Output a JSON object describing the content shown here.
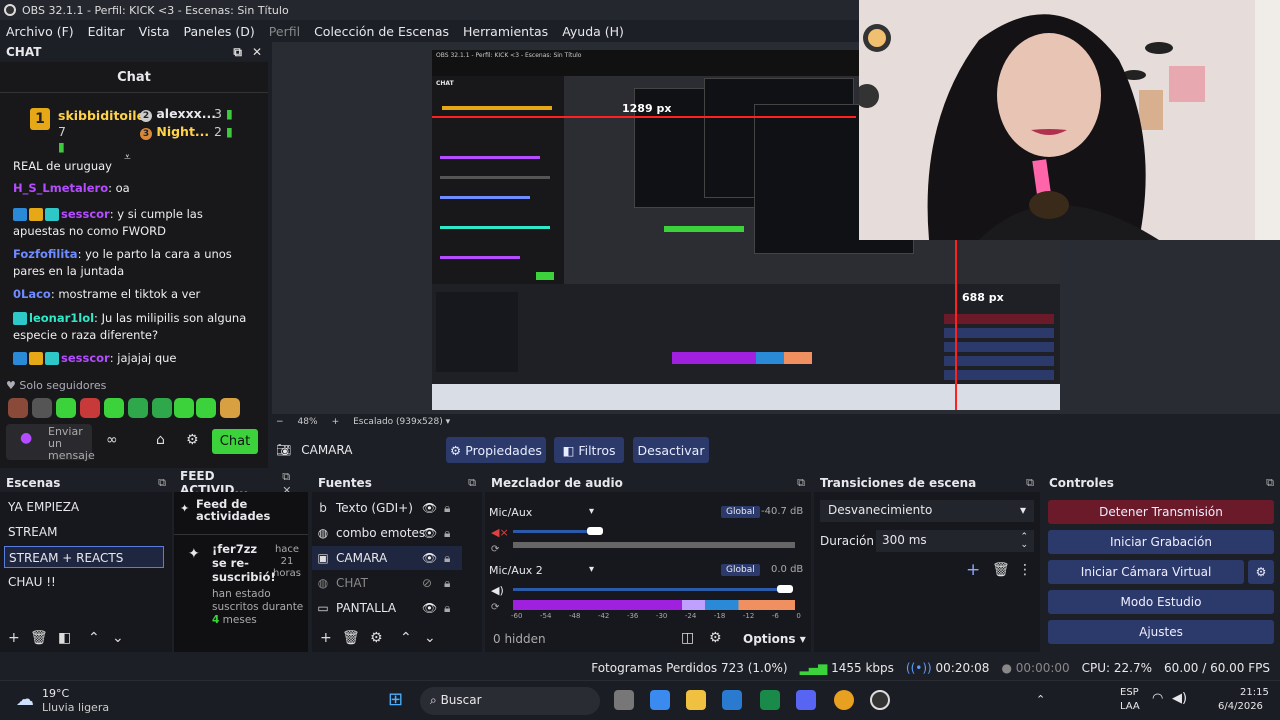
{
  "window": {
    "title": "OBS 32.1.1 - Perfil: KICK <3 - Escenas: Sin Título"
  },
  "menu": [
    "Archivo (F)",
    "Editar",
    "Vista",
    "Paneles (D)",
    "Perfil",
    "Colección de Escenas",
    "Herramientas",
    "Ayuda (H)"
  ],
  "chat": {
    "dock_title": "CHAT",
    "title": "Chat",
    "top": [
      {
        "rank": "1",
        "name": "skibbiditoilet",
        "count": "7"
      },
      {
        "rank": "2",
        "name": "alexxx...",
        "count": "3"
      },
      {
        "rank": "3",
        "name": "Night...",
        "count": "2"
      }
    ],
    "messages": [
      {
        "user": "",
        "text": "REAL de uruguay",
        "color": "#efeff1"
      },
      {
        "user": "H_S_Lmetalero",
        "text": ": oa",
        "color": "#b44cff"
      },
      {
        "user": "sesscor",
        "text": ": y si cumple las apuestas no como FWORD",
        "color": "#b44cff"
      },
      {
        "user": "Fozfofilita",
        "text": ": yo le parto la cara a unos pares en la juntada",
        "color": "#6e8cff"
      },
      {
        "user": "0Laco",
        "text": ": mostrame el tiktok a ver",
        "color": "#6e8cff"
      },
      {
        "user": "leonar1lol",
        "text": ": Ju las milipilis son alguna especie o raza diferente?",
        "color": "#2ee8c8"
      },
      {
        "user": "sesscor",
        "text": ": jajajaj que",
        "color": "#b44cff"
      }
    ],
    "followers_only": "Solo seguidores",
    "input_placeholder": "Enviar un mensaje",
    "send_label": "Chat"
  },
  "preview": {
    "zoom": "48%",
    "scaled": "Escalado (939x528)",
    "measure_h": "1289 px",
    "measure_v": "688 px",
    "nested_title": "OBS 32.1.1 - Perfil: KICK <3 - Escenas: Sin Título"
  },
  "source_toolbar": {
    "current": "CAMARA",
    "properties": "Propiedades",
    "filters": "Filtros",
    "deactivate": "Desactivar"
  },
  "scenes": {
    "title": "Escenas",
    "items": [
      "YA EMPIEZA",
      "STREAM",
      "STREAM + REACTS",
      "CHAU !!"
    ],
    "selected": 2
  },
  "feed": {
    "title": "FEED ACTIVID...",
    "heading": "Feed de actividades",
    "event_user": "¡fer7zz se re-suscribió!",
    "event_time": "hace 21 horas",
    "event_detail_1": "han estado suscritos",
    "event_detail_2": "durante",
    "event_months": "4",
    "event_detail_3": "meses"
  },
  "sources": {
    "title": "Fuentes",
    "items": [
      {
        "name": "Texto (GDI+)",
        "icon": "text-icon"
      },
      {
        "name": "combo emotes",
        "icon": "browser-icon"
      },
      {
        "name": "CAMARA",
        "icon": "camera-icon"
      },
      {
        "name": "CHAT",
        "icon": "browser-icon"
      },
      {
        "name": "PANTALLA",
        "icon": "monitor-icon"
      }
    ]
  },
  "mixer": {
    "title": "Mezclador de audio",
    "channels": [
      {
        "name": "Mic/Aux",
        "mode": "Global",
        "level": "-40.7 dB"
      },
      {
        "name": "Mic/Aux 2",
        "mode": "Global",
        "level": "0.0 dB"
      }
    ],
    "scale": [
      "-60",
      "-54",
      "-48",
      "-42",
      "-36",
      "-30",
      "-24",
      "-18",
      "-12",
      "-6",
      "0"
    ],
    "hidden": "0 hidden",
    "options": "Options"
  },
  "transitions": {
    "title": "Transiciones de escena",
    "type": "Desvanecimiento",
    "duration_label": "Duración",
    "duration": "300 ms"
  },
  "controls": {
    "title": "Controles",
    "buttons": [
      "Detener Transmisión",
      "Iniciar Grabación",
      "Iniciar Cámara Virtual",
      "Modo Estudio",
      "Ajustes"
    ]
  },
  "status": {
    "dropped": "Fotogramas Perdidos 723 (1.0%)",
    "bitrate": "1455 kbps",
    "stream_time": "00:20:08",
    "rec_time": "00:00:00",
    "cpu": "CPU: 22.7%",
    "fps": "60.00 / 60.00 FPS"
  },
  "taskbar": {
    "temp": "19°C",
    "weather": "Lluvia ligera",
    "search": "Buscar",
    "lang1": "ESP",
    "lang2": "LAA",
    "time": "21:15",
    "date": "6/4/2026"
  },
  "colors": {
    "accent_button": "#2c3a6b",
    "stop_button": "#6b1a2a",
    "chat_send": "#3bd23b"
  }
}
